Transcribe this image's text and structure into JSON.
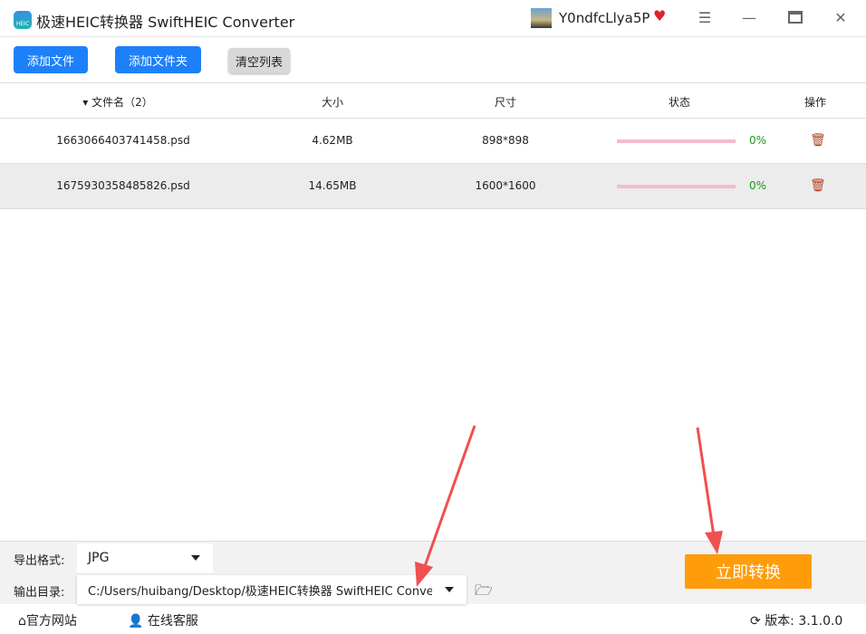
{
  "app": {
    "title": "极速HEIC转换器 SwiftHEIC Converter",
    "logo_text": "HEIC",
    "username": "Y0ndfcLlya5P"
  },
  "toolbar": {
    "add_file": "添加文件",
    "add_folder": "添加文件夹",
    "clear_list": "清空列表"
  },
  "table": {
    "headers": {
      "name": "文件名（2）",
      "size": "大小",
      "dims": "尺寸",
      "status": "状态",
      "action": "操作"
    },
    "rows": [
      {
        "name": "1663066403741458.psd",
        "size": "4.62MB",
        "dims": "898*898",
        "progress": 0,
        "progress_text": "0%"
      },
      {
        "name": "1675930358485826.psd",
        "size": "14.65MB",
        "dims": "1600*1600",
        "progress": 0,
        "progress_text": "0%"
      }
    ]
  },
  "bottom": {
    "format_label": "导出格式:",
    "format_value": "JPG",
    "dir_label": "输出目录:",
    "dir_value": "C:/Users/huibang/Desktop/极速HEIC转换器 SwiftHEIC Converter",
    "convert": "立即转换"
  },
  "footer": {
    "website": "官方网站",
    "support": "在线客服",
    "version_label": "版本:",
    "version": "3.1.0.0"
  },
  "colors": {
    "primary": "#1e80f8",
    "convert": "#ff9c0a",
    "progress": "#f3bccd",
    "percent": "#1a9a1a",
    "annotation_arrow": "#f05050"
  }
}
